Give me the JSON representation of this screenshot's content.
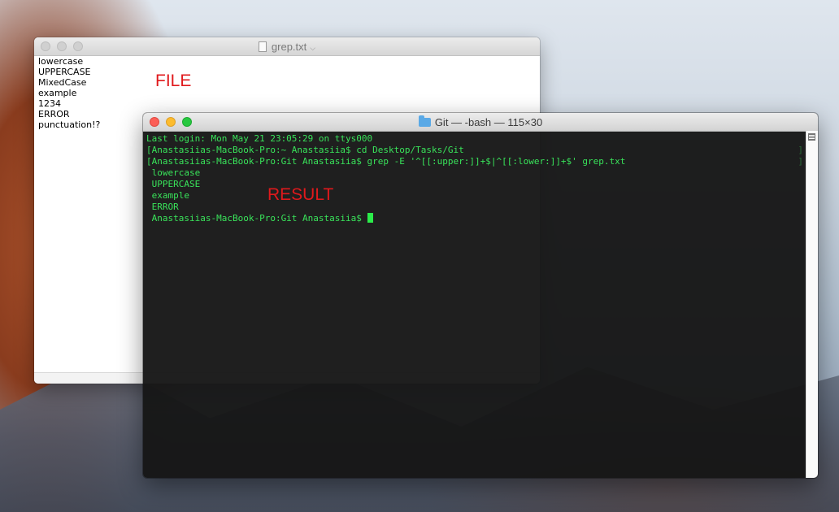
{
  "textedit": {
    "title": "grep.txt",
    "chevron": "⌵",
    "lines": [
      "lowercase",
      "UPPERCASE",
      "MixedCase",
      "example",
      "1234",
      "ERROR",
      "punctuation!?"
    ]
  },
  "annotations": {
    "file_label": "FILE",
    "result_label": "RESULT",
    "color": "#e0191c"
  },
  "terminal": {
    "title": "Git — -bash — 115×30",
    "bracket": "]",
    "lines": [
      "Last login: Mon May 21 23:05:29 on ttys000",
      "[Anastasiias-MacBook-Pro:~ Anastasiia$ cd Desktop/Tasks/Git",
      "[Anastasiias-MacBook-Pro:Git Anastasiia$ grep -E '^[[:upper:]]+$|^[[:lower:]]+$' grep.txt",
      " lowercase",
      " UPPERCASE",
      " example",
      " ERROR"
    ],
    "prompt": " Anastasiias-MacBook-Pro:Git Anastasiia$ ",
    "text_color": "#39e35a"
  }
}
